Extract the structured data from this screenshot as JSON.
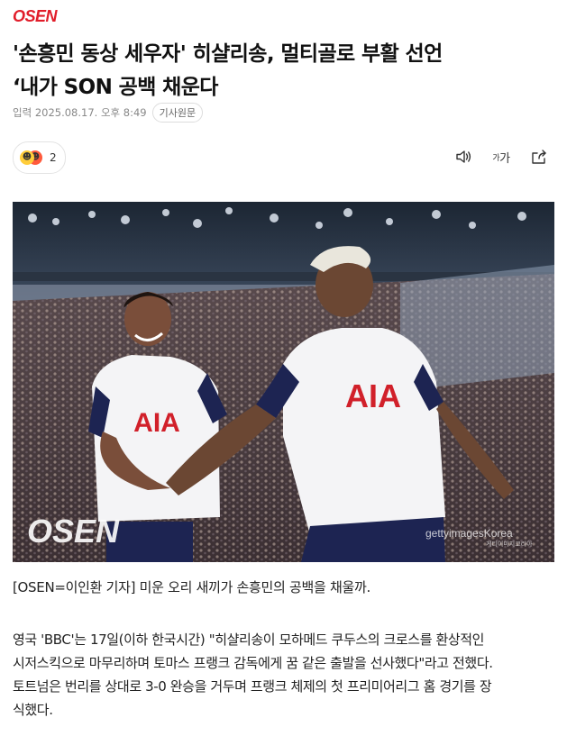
{
  "site": {
    "logo": "OSEN"
  },
  "article": {
    "headline_lines": [
      "'손흥민 동상 세우자' 히샬리송, 멀티골로 부활 선언",
      "‘내가 SON 공백 채운다"
    ],
    "published": "입력 2025.08.17. 오후 8:49",
    "source_button": "기사원문",
    "reaction_count": "2",
    "tools": {
      "audio_icon": "speaker-icon",
      "font_label_small": "가",
      "font_label_large": "가",
      "share_icon": "share-icon"
    },
    "photo": {
      "watermark": "OSEN",
      "credit": "gettyimagesKorea",
      "credit_sub": "게티이미지코리아",
      "jersey_sponsor": "AIA"
    },
    "caption": "[OSEN=이인환 기자] 미운 오리 새끼가 손흥민의 공백을 채울까.",
    "body_lines": [
      "영국 'BBC'는 17일(이하 한국시간) \"히샬리송이 모하메드 쿠두스의 크로스를 환상적인",
      "시저스킥으로 마무리하며 토마스 프랭크 감독에게 꿈 같은 출발을 선사했다\"라고 전했다.",
      "토트넘은 번리를 상대로 3-0 완승을 거두며 프랭크 체제의 첫 프리미어리그 홈 경기를 장",
      "식했다."
    ]
  },
  "colors": {
    "brand": "#e11d2a",
    "text": "#111111",
    "meta": "#888888",
    "kit_navy": "#1d2452",
    "sponsor_red": "#d1202a"
  }
}
